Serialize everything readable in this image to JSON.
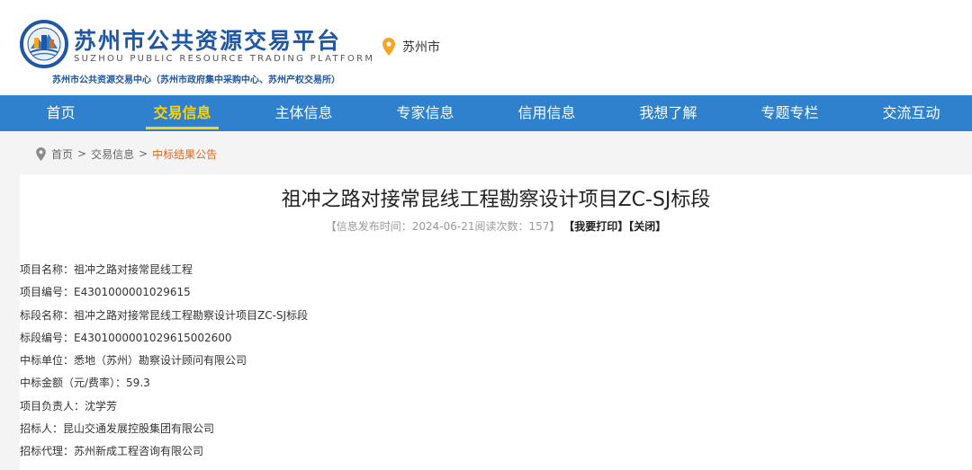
{
  "header": {
    "title": "苏州市公共资源交易平台",
    "title_en": "SUZHOU PUBLIC RESOURCE TRADING PLATFORM",
    "subtitle": "苏州市公共资源交易中心（苏州市政府集中采购中心、苏州产权交易所）",
    "location": "苏州市",
    "location_icon": "map-pin-icon",
    "colors": {
      "brand": "#1f56a5",
      "nav": "#2f80cd",
      "accent": "#ffd400",
      "crumb_current": "#e1661b",
      "pin": "#f5a623"
    }
  },
  "nav": {
    "items": [
      {
        "label": "首页"
      },
      {
        "label": "交易信息"
      },
      {
        "label": "主体信息"
      },
      {
        "label": "专家信息"
      },
      {
        "label": "信用信息"
      },
      {
        "label": "我想了解"
      },
      {
        "label": "专题专栏"
      },
      {
        "label": "交流互动"
      }
    ],
    "active": "交易信息"
  },
  "breadcrumb": {
    "icon": "location-icon",
    "home": "首页",
    "sep": ">",
    "level1": "交易信息",
    "current": "中标结果公告"
  },
  "article": {
    "title": "祖冲之路对接常昆线工程勘察设计项目ZC-SJ标段",
    "meta": {
      "info": "【信息发布时间：2024-06-21阅读次数：157】",
      "print": "【我要打印】",
      "close": "【关闭】"
    },
    "fields": [
      "项目名称：祖冲之路对接常昆线工程",
      "项目编号：E4301000001029615",
      "标段名称：祖冲之路对接常昆线工程勘察设计项目ZC-SJ标段",
      "标段编号：E4301000001029615002600",
      "中标单位：悉地（苏州）勘察设计顾问有限公司",
      "中标金额（元/费率）：59.3",
      "项目负责人：沈学芳",
      "招标人：昆山交通发展控股集团有限公司",
      "招标代理：苏州新成工程咨询有限公司"
    ]
  }
}
